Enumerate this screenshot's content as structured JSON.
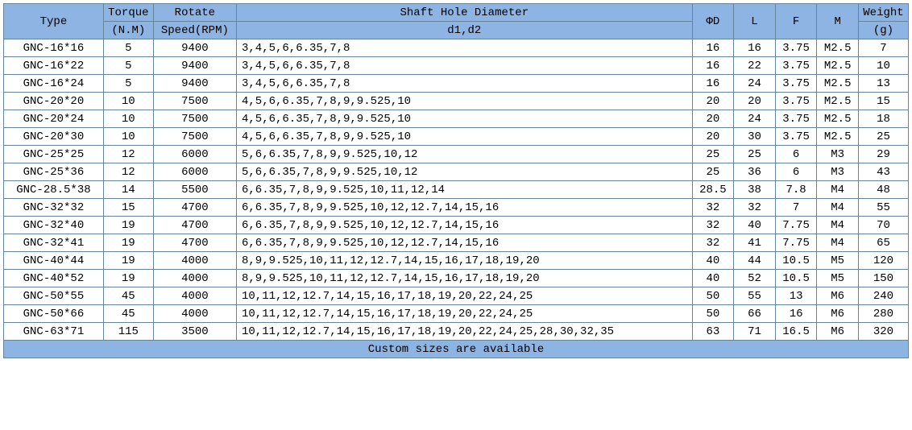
{
  "headers": {
    "type": "Type",
    "torque": "Torque",
    "torque_unit": "(N.M)",
    "speed": "Rotate",
    "speed_unit": "Speed(RPM)",
    "shaft": "Shaft Hole Diameter",
    "d1d2": "d1,d2",
    "phid": "ΦD",
    "l": "L",
    "f": "F",
    "m": "M",
    "weight": "Weight",
    "weight_unit": "(g)"
  },
  "rows": [
    {
      "type": "GNC-16*16",
      "torque": "5",
      "speed": "9400",
      "d1d2": "3,4,5,6,6.35,7,8",
      "phid": "16",
      "l": "16",
      "f": "3.75",
      "m": "M2.5",
      "wt": "7"
    },
    {
      "type": "GNC-16*22",
      "torque": "5",
      "speed": "9400",
      "d1d2": "3,4,5,6,6.35,7,8",
      "phid": "16",
      "l": "22",
      "f": "3.75",
      "m": "M2.5",
      "wt": "10"
    },
    {
      "type": "GNC-16*24",
      "torque": "5",
      "speed": "9400",
      "d1d2": "3,4,5,6,6.35,7,8",
      "phid": "16",
      "l": "24",
      "f": "3.75",
      "m": "M2.5",
      "wt": "13"
    },
    {
      "type": "GNC-20*20",
      "torque": "10",
      "speed": "7500",
      "d1d2": "4,5,6,6.35,7,8,9,9.525,10",
      "phid": "20",
      "l": "20",
      "f": "3.75",
      "m": "M2.5",
      "wt": "15"
    },
    {
      "type": "GNC-20*24",
      "torque": "10",
      "speed": "7500",
      "d1d2": "4,5,6,6.35,7,8,9,9.525,10",
      "phid": "20",
      "l": "24",
      "f": "3.75",
      "m": "M2.5",
      "wt": "18"
    },
    {
      "type": "GNC-20*30",
      "torque": "10",
      "speed": "7500",
      "d1d2": "4,5,6,6.35,7,8,9,9.525,10",
      "phid": "20",
      "l": "30",
      "f": "3.75",
      "m": "M2.5",
      "wt": "25"
    },
    {
      "type": "GNC-25*25",
      "torque": "12",
      "speed": "6000",
      "d1d2": "5,6,6.35,7,8,9,9.525,10,12",
      "phid": "25",
      "l": "25",
      "f": "6",
      "m": "M3",
      "wt": "29"
    },
    {
      "type": "GNC-25*36",
      "torque": "12",
      "speed": "6000",
      "d1d2": "5,6,6.35,7,8,9,9.525,10,12",
      "phid": "25",
      "l": "36",
      "f": "6",
      "m": "M3",
      "wt": "43"
    },
    {
      "type": "GNC-28.5*38",
      "torque": "14",
      "speed": "5500",
      "d1d2": "6,6.35,7,8,9,9.525,10,11,12,14",
      "phid": "28.5",
      "l": "38",
      "f": "7.8",
      "m": "M4",
      "wt": "48"
    },
    {
      "type": "GNC-32*32",
      "torque": "15",
      "speed": "4700",
      "d1d2": "6,6.35,7,8,9,9.525,10,12,12.7,14,15,16",
      "phid": "32",
      "l": "32",
      "f": "7",
      "m": "M4",
      "wt": "55"
    },
    {
      "type": "GNC-32*40",
      "torque": "19",
      "speed": "4700",
      "d1d2": "6,6.35,7,8,9,9.525,10,12,12.7,14,15,16",
      "phid": "32",
      "l": "40",
      "f": "7.75",
      "m": "M4",
      "wt": "70"
    },
    {
      "type": "GNC-32*41",
      "torque": "19",
      "speed": "4700",
      "d1d2": "6,6.35,7,8,9,9.525,10,12,12.7,14,15,16",
      "phid": "32",
      "l": "41",
      "f": "7.75",
      "m": "M4",
      "wt": "65"
    },
    {
      "type": "GNC-40*44",
      "torque": "19",
      "speed": "4000",
      "d1d2": "8,9,9.525,10,11,12,12.7,14,15,16,17,18,19,20",
      "phid": "40",
      "l": "44",
      "f": "10.5",
      "m": "M5",
      "wt": "120"
    },
    {
      "type": "GNC-40*52",
      "torque": "19",
      "speed": "4000",
      "d1d2": "8,9,9.525,10,11,12,12.7,14,15,16,17,18,19,20",
      "phid": "40",
      "l": "52",
      "f": "10.5",
      "m": "M5",
      "wt": "150"
    },
    {
      "type": "GNC-50*55",
      "torque": "45",
      "speed": "4000",
      "d1d2": "10,11,12,12.7,14,15,16,17,18,19,20,22,24,25",
      "phid": "50",
      "l": "55",
      "f": "13",
      "m": "M6",
      "wt": "240"
    },
    {
      "type": "GNC-50*66",
      "torque": "45",
      "speed": "4000",
      "d1d2": "10,11,12,12.7,14,15,16,17,18,19,20,22,24,25",
      "phid": "50",
      "l": "66",
      "f": "16",
      "m": "M6",
      "wt": "280"
    },
    {
      "type": "GNC-63*71",
      "torque": "115",
      "speed": "3500",
      "d1d2": "10,11,12,12.7,14,15,16,17,18,19,20,22,24,25,28,30,32,35",
      "phid": "63",
      "l": "71",
      "f": "16.5",
      "m": "M6",
      "wt": "320"
    }
  ],
  "footer": "Custom sizes are available"
}
